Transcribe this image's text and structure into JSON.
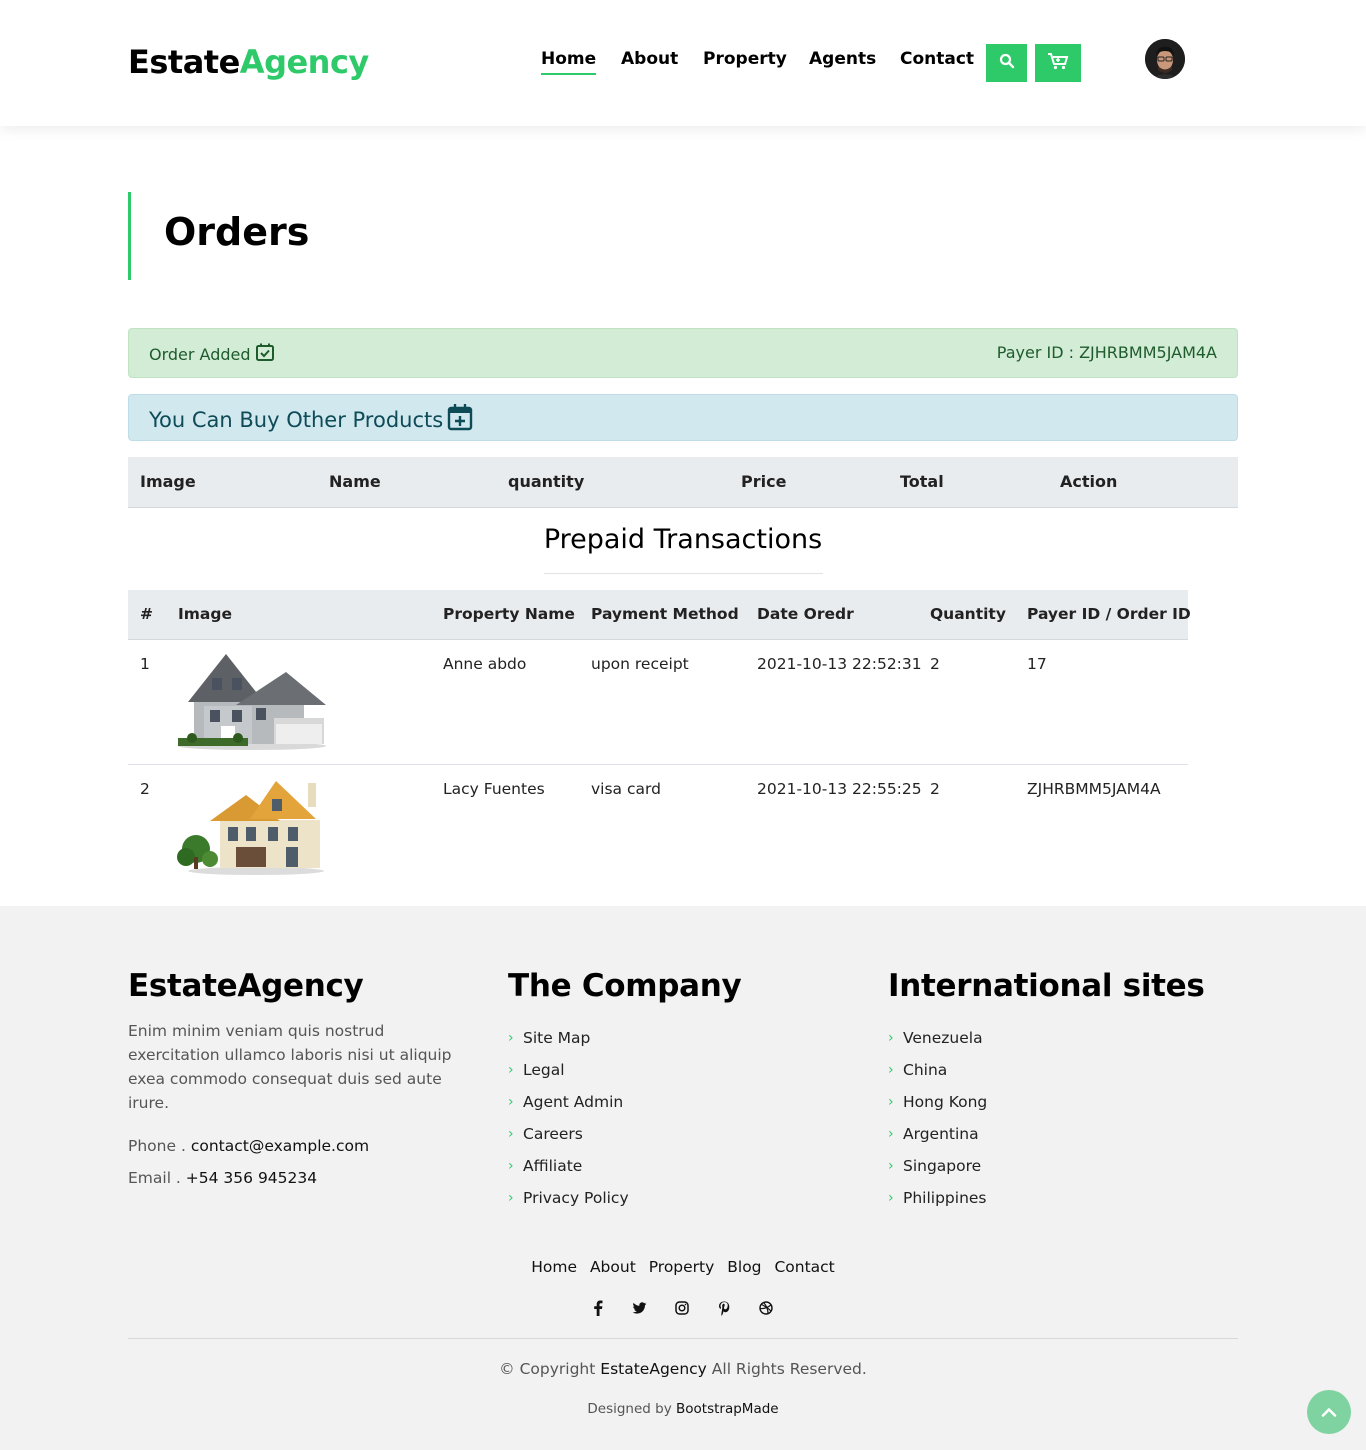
{
  "brand": {
    "part1": "Estate",
    "part2": "Agency"
  },
  "nav": [
    {
      "label": "Home",
      "active": true
    },
    {
      "label": "About"
    },
    {
      "label": "Property"
    },
    {
      "label": "Agents"
    },
    {
      "label": "Contact"
    }
  ],
  "icons": {
    "search": "search-icon",
    "cart": "cart-icon",
    "avatar": "avatar"
  },
  "page": {
    "title": "Orders"
  },
  "alert_order": {
    "label": "Order Added",
    "payer": "Payer ID : ZJHRBMM5JAM4A"
  },
  "alert_buy": {
    "label": "You Can Buy Other Products"
  },
  "cart_table": {
    "headers": [
      "Image",
      "Name",
      "quantity",
      "Price",
      "Total",
      "Action"
    ]
  },
  "prepaid": {
    "title": "Prepaid Transactions",
    "headers": [
      "#",
      "Image",
      "Property Name",
      "Payment Method",
      "Date Oredr",
      "Quantity",
      "Payer ID / Order ID"
    ],
    "rows": [
      {
        "num": "1",
        "name": "Anne abdo",
        "method": "upon receipt",
        "date": "2021-10-13 22:52:31",
        "qty": "2",
        "payer": "17"
      },
      {
        "num": "2",
        "name": "Lacy Fuentes",
        "method": "visa card",
        "date": "2021-10-13 22:55:25",
        "qty": "2",
        "payer": "ZJHRBMM5JAM4A"
      }
    ]
  },
  "footer": {
    "brand": "EstateAgency",
    "description": "Enim minim veniam quis nostrud exercitation ullamco laboris nisi ut aliquip exea commodo consequat duis sed aute irure.",
    "phone_label": "Phone .",
    "phone_value": "contact@example.com",
    "email_label": "Email .",
    "email_value": "+54 356 945234",
    "company_title": "The Company",
    "company_links": [
      "Site Map",
      "Legal",
      "Agent Admin",
      "Careers",
      "Affiliate",
      "Privacy Policy"
    ],
    "intl_title": "International sites",
    "intl_links": [
      "Venezuela",
      "China",
      "Hong Kong",
      "Argentina",
      "Singapore",
      "Philippines"
    ],
    "bottom_nav": [
      "Home",
      "About",
      "Property",
      "Blog",
      "Contact"
    ],
    "copyright_prefix": "© Copyright",
    "copyright_brand": "EstateAgency",
    "copyright_suffix": "All Rights Reserved.",
    "designed_prefix": "Designed by",
    "designed_brand": "BootstrapMade"
  },
  "colors": {
    "accent": "#2eca6a",
    "success_bg": "#d3ecd5",
    "info_bg": "#d1e8ef"
  }
}
